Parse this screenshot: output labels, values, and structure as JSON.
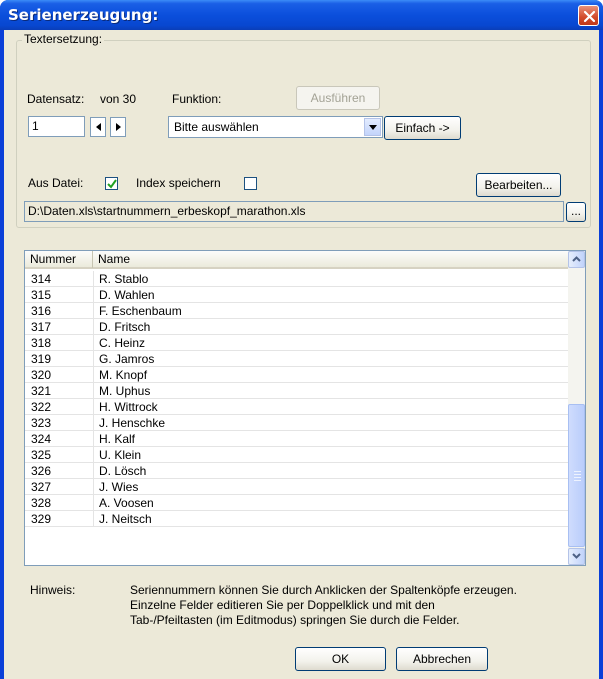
{
  "window": {
    "title": "Serienerzeugung:"
  },
  "group": {
    "legend": "Textersetzung:",
    "datensatz_label": "Datensatz:",
    "von_label": "von 30",
    "record_value": "1",
    "funktion_label": "Funktion:",
    "ausfuehren_label": "Ausführen",
    "funktion_selected": "Bitte auswählen",
    "einfach_label": "Einfach ->",
    "aus_datei_label": "Aus Datei:",
    "aus_datei_checked": true,
    "index_label": "Index speichern",
    "index_checked": false,
    "bearbeiten_label": "Bearbeiten...",
    "file_path": "D:\\Daten.xls\\startnummern_erbeskopf_marathon.xls",
    "browse_label": "..."
  },
  "table": {
    "columns": [
      "Nummer",
      "Name"
    ],
    "rows": [
      {
        "num": "314",
        "name": "R. Stablo"
      },
      {
        "num": "315",
        "name": "D. Wahlen"
      },
      {
        "num": "316",
        "name": "F. Eschenbaum"
      },
      {
        "num": "317",
        "name": "D. Fritsch"
      },
      {
        "num": "318",
        "name": "C. Heinz"
      },
      {
        "num": "319",
        "name": "G. Jamros"
      },
      {
        "num": "320",
        "name": "M. Knopf"
      },
      {
        "num": "321",
        "name": "M. Uphus"
      },
      {
        "num": "322",
        "name": "H. Wittrock"
      },
      {
        "num": "323",
        "name": "J. Henschke"
      },
      {
        "num": "324",
        "name": "H. Kalf"
      },
      {
        "num": "325",
        "name": "U. Klein"
      },
      {
        "num": "326",
        "name": "D. Lösch"
      },
      {
        "num": "327",
        "name": "J. Wies"
      },
      {
        "num": "328",
        "name": "A. Voosen"
      },
      {
        "num": "329",
        "name": "J. Neitsch"
      }
    ]
  },
  "hint": {
    "label": "Hinweis:",
    "lines": [
      "Seriennummern können Sie durch Anklicken der Spaltenköpfe erzeugen.",
      "Einzelne Felder editieren Sie per Doppelklick und mit den",
      "Tab-/Pfeiltasten (im Editmodus) springen Sie durch die Felder."
    ]
  },
  "buttons": {
    "ok": "OK",
    "cancel": "Abbrechen"
  },
  "icons": {
    "close": "close-icon",
    "spin_left": "arrow-left-icon",
    "spin_right": "arrow-right-icon",
    "dropdown": "chevron-down-icon",
    "check": "checkmark-icon",
    "scroll_up": "chevron-up-icon",
    "scroll_down": "chevron-down-icon"
  },
  "colors": {
    "titlebar": "#0b4fdc",
    "dialog_bg": "#ece9d8",
    "close_button": "#d24a2a"
  }
}
